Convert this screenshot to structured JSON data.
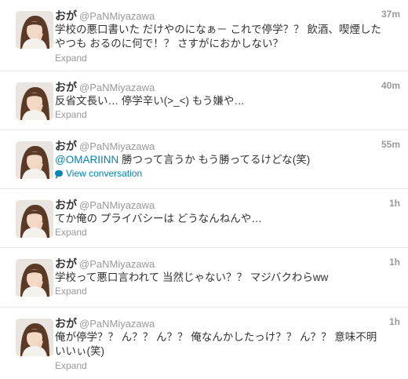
{
  "tweets": [
    {
      "name": "おが",
      "handle": "@PaNMiyazawa",
      "time": "37m",
      "text": "学校の悪口書いた だけやのになぁ－ これで停学？？ 飲酒、喫煙したやつも おるのに何で！？ さすがにおかしない？",
      "action": "Expand"
    },
    {
      "name": "おが",
      "handle": "@PaNMiyazawa",
      "time": "40m",
      "text": "反省文長い… 停学辛い(>_<) もう嫌や…",
      "action": "Expand"
    },
    {
      "name": "おが",
      "handle": "@PaNMiyazawa",
      "time": "55m",
      "mention": "@OMARIINN",
      "text": " 勝つって言うか もう勝ってるけどな(笑)",
      "action": "View conversation"
    },
    {
      "name": "おが",
      "handle": "@PaNMiyazawa",
      "time": "1h",
      "text": "てか俺の プライバシーは どうなんねんや…",
      "action": "Expand"
    },
    {
      "name": "おが",
      "handle": "@PaNMiyazawa",
      "time": "1h",
      "text": "学校って悪口言われて 当然じゃない？？ マジバクわらww",
      "action": "Expand"
    },
    {
      "name": "おが",
      "handle": "@PaNMiyazawa",
      "time": "1h",
      "text": "俺が停学？？ ん？？ ん？？ 俺なんかしたっけ？？ ん？？ 意味不明いいぃ(笑)",
      "action": "Expand"
    }
  ],
  "colors": {
    "link": "#0084b4",
    "muted": "#999999",
    "text": "#333333",
    "divider": "#e8e8e8"
  },
  "icons": {
    "avatar": "user-photo-avatar",
    "conversation": "speech-bubble-icon"
  }
}
